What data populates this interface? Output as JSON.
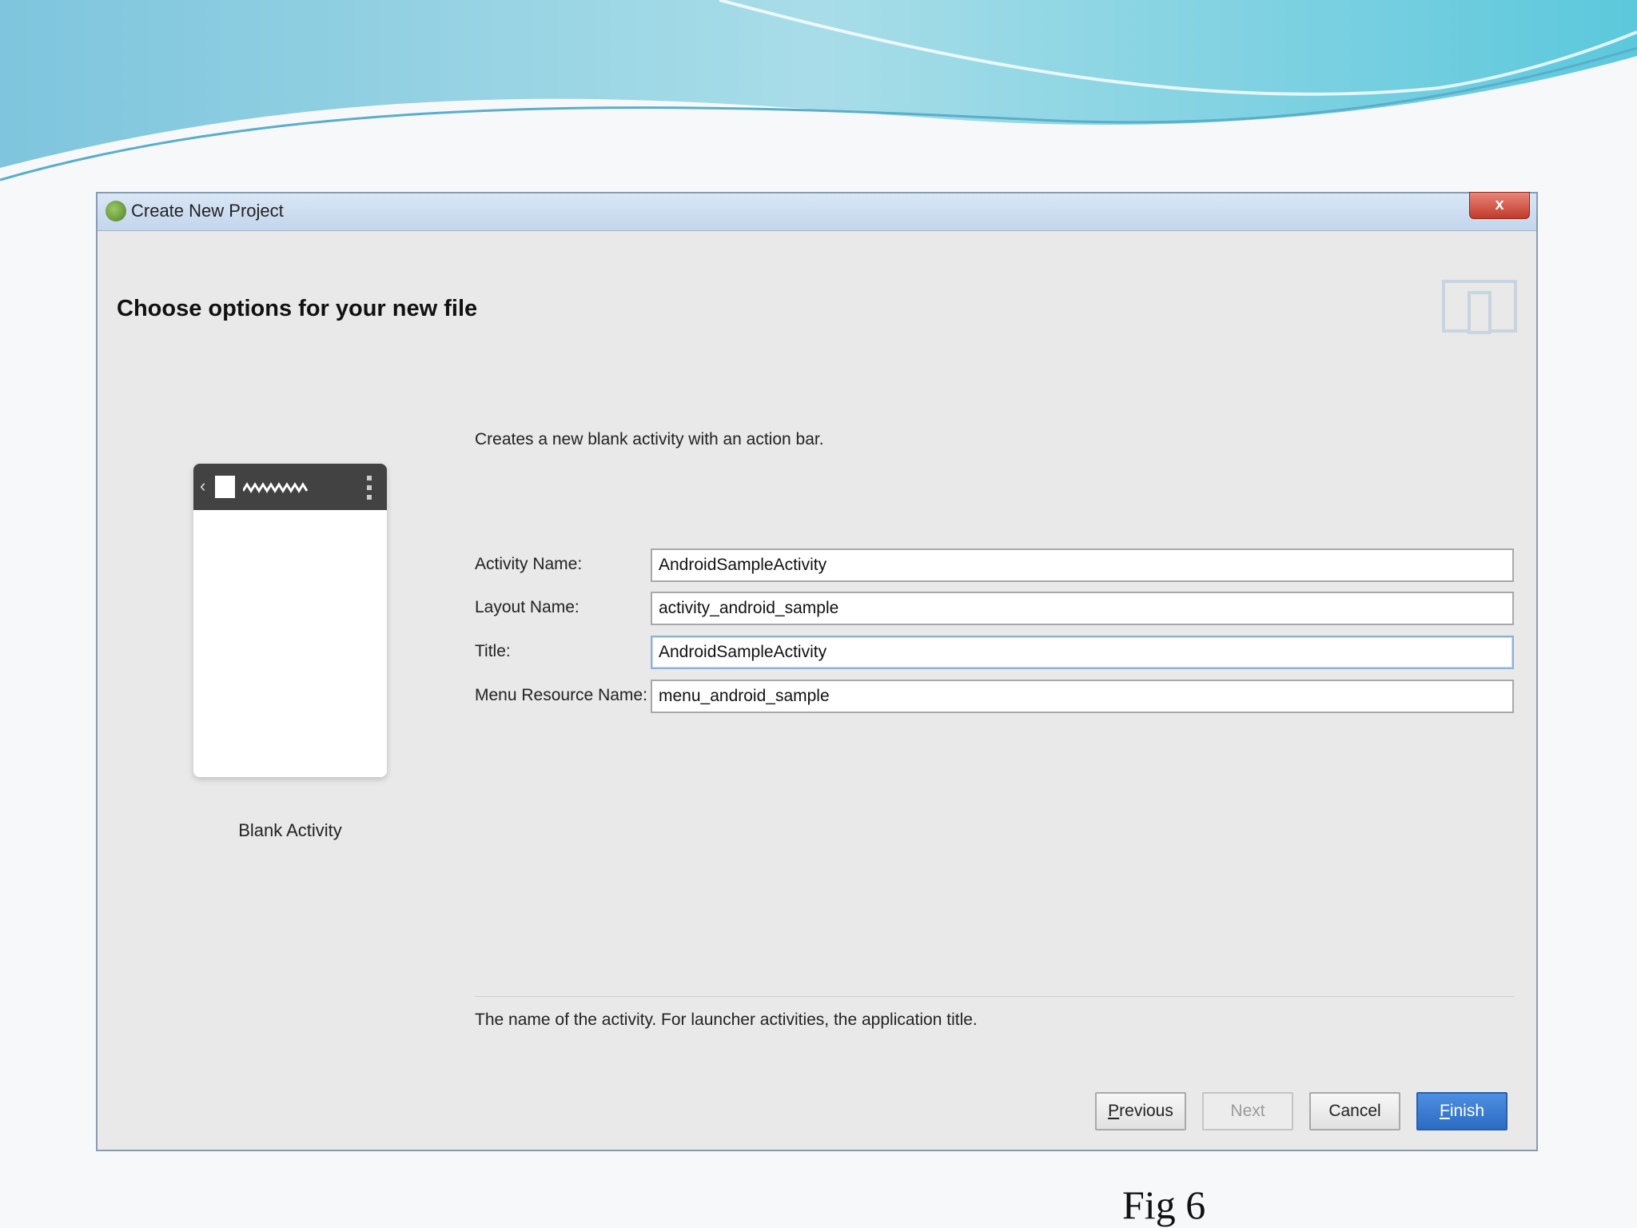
{
  "slide": {
    "caption": "Fig 6"
  },
  "dialog": {
    "window_title": "Create New Project",
    "close_label": "x",
    "header_title": "Choose options for your new file",
    "description": "Creates a new blank activity with an action bar.",
    "preview_label": "Blank Activity",
    "fields": [
      {
        "label": "Activity Name:",
        "value": "AndroidSampleActivity"
      },
      {
        "label": "Layout Name:",
        "value": "activity_android_sample"
      },
      {
        "label": "Title:",
        "value": "AndroidSampleActivity"
      },
      {
        "label": "Menu Resource Name:",
        "value": "menu_android_sample"
      }
    ],
    "help_text": "The name of the activity. For launcher activities, the application title.",
    "buttons": {
      "previous": {
        "mnemonic": "P",
        "rest": "revious"
      },
      "next": "Next",
      "cancel": "Cancel",
      "finish": {
        "mnemonic": "F",
        "rest": "inish"
      }
    }
  },
  "colors": {
    "accent": "#2c6cc4",
    "dialog_bg": "#e9e9ea",
    "preview_bar": "#424242"
  },
  "icons": [
    "android-studio-icon",
    "close-icon",
    "device-layout-icon",
    "back-arrow-icon",
    "overflow-menu-icon"
  ]
}
